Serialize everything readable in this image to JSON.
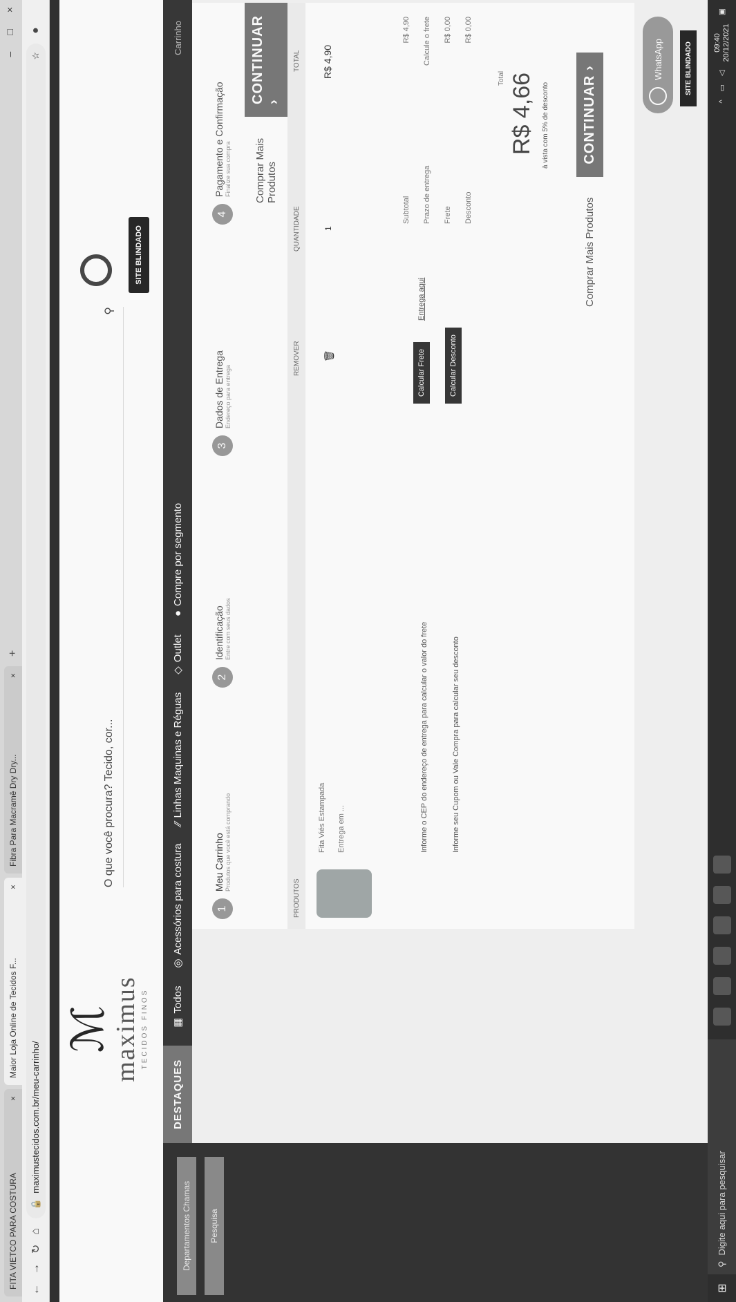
{
  "browser": {
    "tabs": [
      {
        "title": "FITA VIETCO PARA COSTURA",
        "active": false
      },
      {
        "title": "Maior Loja Online de Tecidos F...",
        "active": true
      },
      {
        "title": "Fibra Para Macramê Dry Dry...",
        "active": false
      }
    ],
    "url": "maximustecidos.com.br/meu-carrinho/"
  },
  "site": {
    "logo_mark": "ℳ",
    "logo_name": "maximus",
    "logo_sub": "TECIDOS FINOS",
    "search_placeholder": "O que você procura? Tecido, cor...",
    "seal": "SITE BLINDADO"
  },
  "nav": {
    "featured": "DESTAQUES",
    "items": [
      "Todos",
      "Acessórios para costura",
      "Linhas Maquinas e Réguas",
      "Outlet",
      "Compre por segmento"
    ],
    "right": "Carrinho"
  },
  "left_buttons": [
    "Departamentos Chamas",
    "Pesquisa"
  ],
  "steps": [
    {
      "n": "1",
      "label": "Meu Carrinho",
      "sub": "Produtos que você está comprando"
    },
    {
      "n": "2",
      "label": "Identificação",
      "sub": "Entre com seus dados"
    },
    {
      "n": "3",
      "label": "Dados de Entrega",
      "sub": "Endereço para entrega"
    },
    {
      "n": "4",
      "label": "Pagamento e Confirmação",
      "sub": "Finalize sua compra"
    }
  ],
  "actions": {
    "continue": "CONTINUAR",
    "more": "Comprar Mais Produtos"
  },
  "table_headers": {
    "product": "PRODUTOS",
    "remove": "REMOVER",
    "qty": "QUANTIDADE",
    "total": "TOTAL"
  },
  "product": {
    "name": "Fita Viés Estampada",
    "foot": "Entrega em ...",
    "qty": "1",
    "price": "R$ 4,90"
  },
  "frete": {
    "info": "Informe o CEP do endereço de entrega para calcular o valor do frete",
    "button": "Calcular Frete",
    "link": "Entrega aqui",
    "coupon_info": "Informe seu Cupom ou Vale Compra para calcular seu desconto",
    "coupon_button": "Calcular Desconto"
  },
  "summary": [
    {
      "label": "Subtotal",
      "value": "R$ 4,90"
    },
    {
      "label": "Prazo de entrega",
      "value": "Calcule o frete"
    },
    {
      "label": "Frete",
      "value": "R$ 0,00"
    },
    {
      "label": "Desconto",
      "value": "R$ 0,00"
    }
  ],
  "total": {
    "label": "Total",
    "value": "R$ 4,66",
    "note": "à vista com 5% de desconto"
  },
  "whatsapp": "WhatsApp",
  "taskbar": {
    "search": "Digite aqui para pesquisar",
    "time": "09:40",
    "date": "20/12/2021"
  }
}
